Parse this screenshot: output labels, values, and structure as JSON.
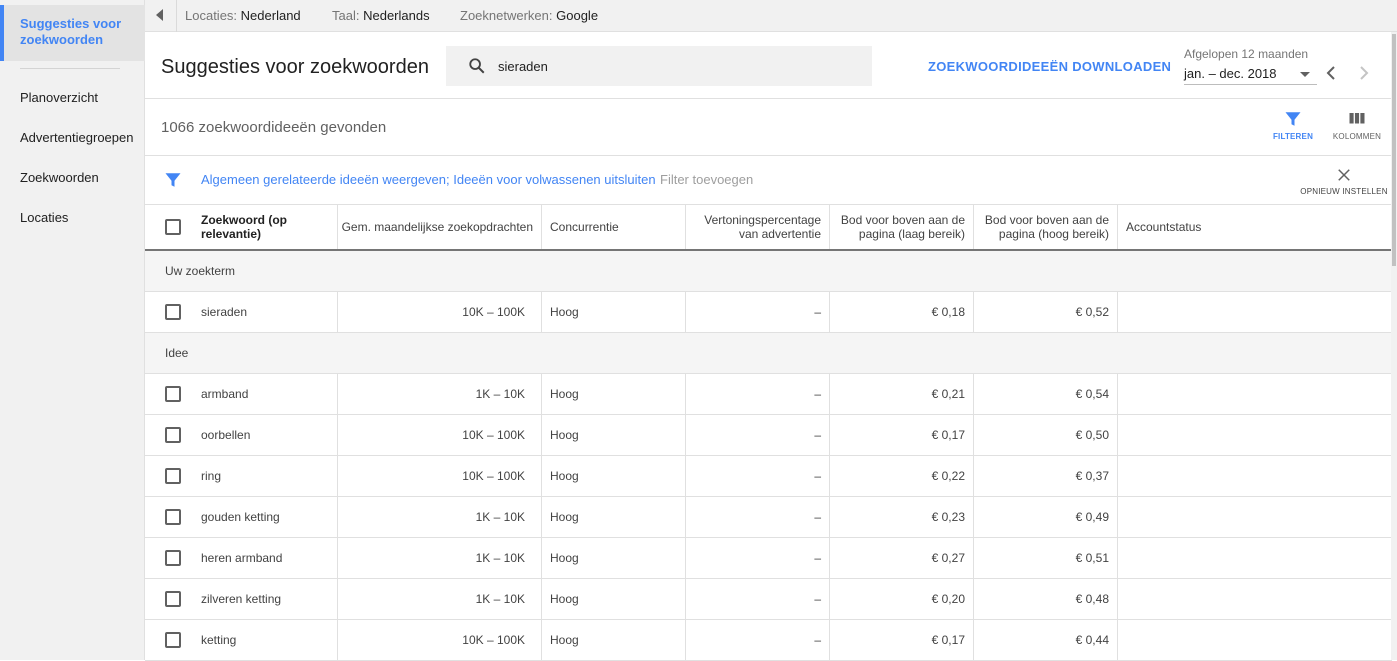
{
  "sidebar": {
    "active_label": "Suggesties voor zoekwoorden",
    "items": [
      "Planoverzicht",
      "Advertentiegroepen",
      "Zoekwoorden",
      "Locaties"
    ]
  },
  "topbar": {
    "locations_key": "Locaties:",
    "locations_value": "Nederland",
    "language_key": "Taal:",
    "language_value": "Nederlands",
    "networks_key": "Zoeknetwerken:",
    "networks_value": "Google"
  },
  "header": {
    "title": "Suggesties voor zoekwoorden",
    "search_value": "sieraden",
    "download_label": "ZOEKWOORDIDEEËN DOWNLOADEN",
    "date_range_label": "Afgelopen 12 maanden",
    "date_range_value": "jan. – dec. 2018"
  },
  "results": {
    "count_text": "1066 zoekwoordideeën gevonden",
    "filter_label": "FILTEREN",
    "columns_label": "KOLOMMEN"
  },
  "filterbar": {
    "active_filters": "Algemeen gerelateerde ideeën weergeven; Ideeën voor volwassenen uitsluiten",
    "add_filter": "Filter toevoegen",
    "reset_label": "OPNIEUW INSTELLEN"
  },
  "table": {
    "headers": {
      "keyword": "Zoekwoord (op relevantie)",
      "searches": "Gem. maandelijkse zoekopdrachten",
      "competition": "Concurrentie",
      "impression_share": "Vertoningspercentage van advertentie",
      "bid_low": "Bod voor boven aan de pagina (laag bereik)",
      "bid_high": "Bod voor boven aan de pagina (hoog bereik)",
      "account_status": "Accountstatus"
    },
    "groups": [
      {
        "label": "Uw zoekterm",
        "rows": [
          {
            "keyword": "sieraden",
            "searches": "10K – 100K",
            "competition": "Hoog",
            "share": "–",
            "low": "€ 0,18",
            "high": "€ 0,52"
          }
        ]
      },
      {
        "label": "Idee",
        "rows": [
          {
            "keyword": "armband",
            "searches": "1K – 10K",
            "competition": "Hoog",
            "share": "–",
            "low": "€ 0,21",
            "high": "€ 0,54"
          },
          {
            "keyword": "oorbellen",
            "searches": "10K – 100K",
            "competition": "Hoog",
            "share": "–",
            "low": "€ 0,17",
            "high": "€ 0,50"
          },
          {
            "keyword": "ring",
            "searches": "10K – 100K",
            "competition": "Hoog",
            "share": "–",
            "low": "€ 0,22",
            "high": "€ 0,37"
          },
          {
            "keyword": "gouden ketting",
            "searches": "1K – 10K",
            "competition": "Hoog",
            "share": "–",
            "low": "€ 0,23",
            "high": "€ 0,49"
          },
          {
            "keyword": "heren armband",
            "searches": "1K – 10K",
            "competition": "Hoog",
            "share": "–",
            "low": "€ 0,27",
            "high": "€ 0,51"
          },
          {
            "keyword": "zilveren ketting",
            "searches": "1K – 10K",
            "competition": "Hoog",
            "share": "–",
            "low": "€ 0,20",
            "high": "€ 0,48"
          },
          {
            "keyword": "ketting",
            "searches": "10K – 100K",
            "competition": "Hoog",
            "share": "–",
            "low": "€ 0,17",
            "high": "€ 0,44"
          }
        ]
      }
    ]
  },
  "colors": {
    "accent": "#4285f4",
    "sidebar_bg": "#f1f1f1",
    "text": "#212121",
    "muted": "#757575"
  },
  "icons": {
    "back": "triangle-left-icon",
    "search": "search-icon",
    "filter": "funnel-icon",
    "columns": "columns-icon",
    "close": "close-icon",
    "prev": "chevron-left-icon",
    "next": "chevron-right-icon",
    "dropdown": "caret-down-icon"
  }
}
